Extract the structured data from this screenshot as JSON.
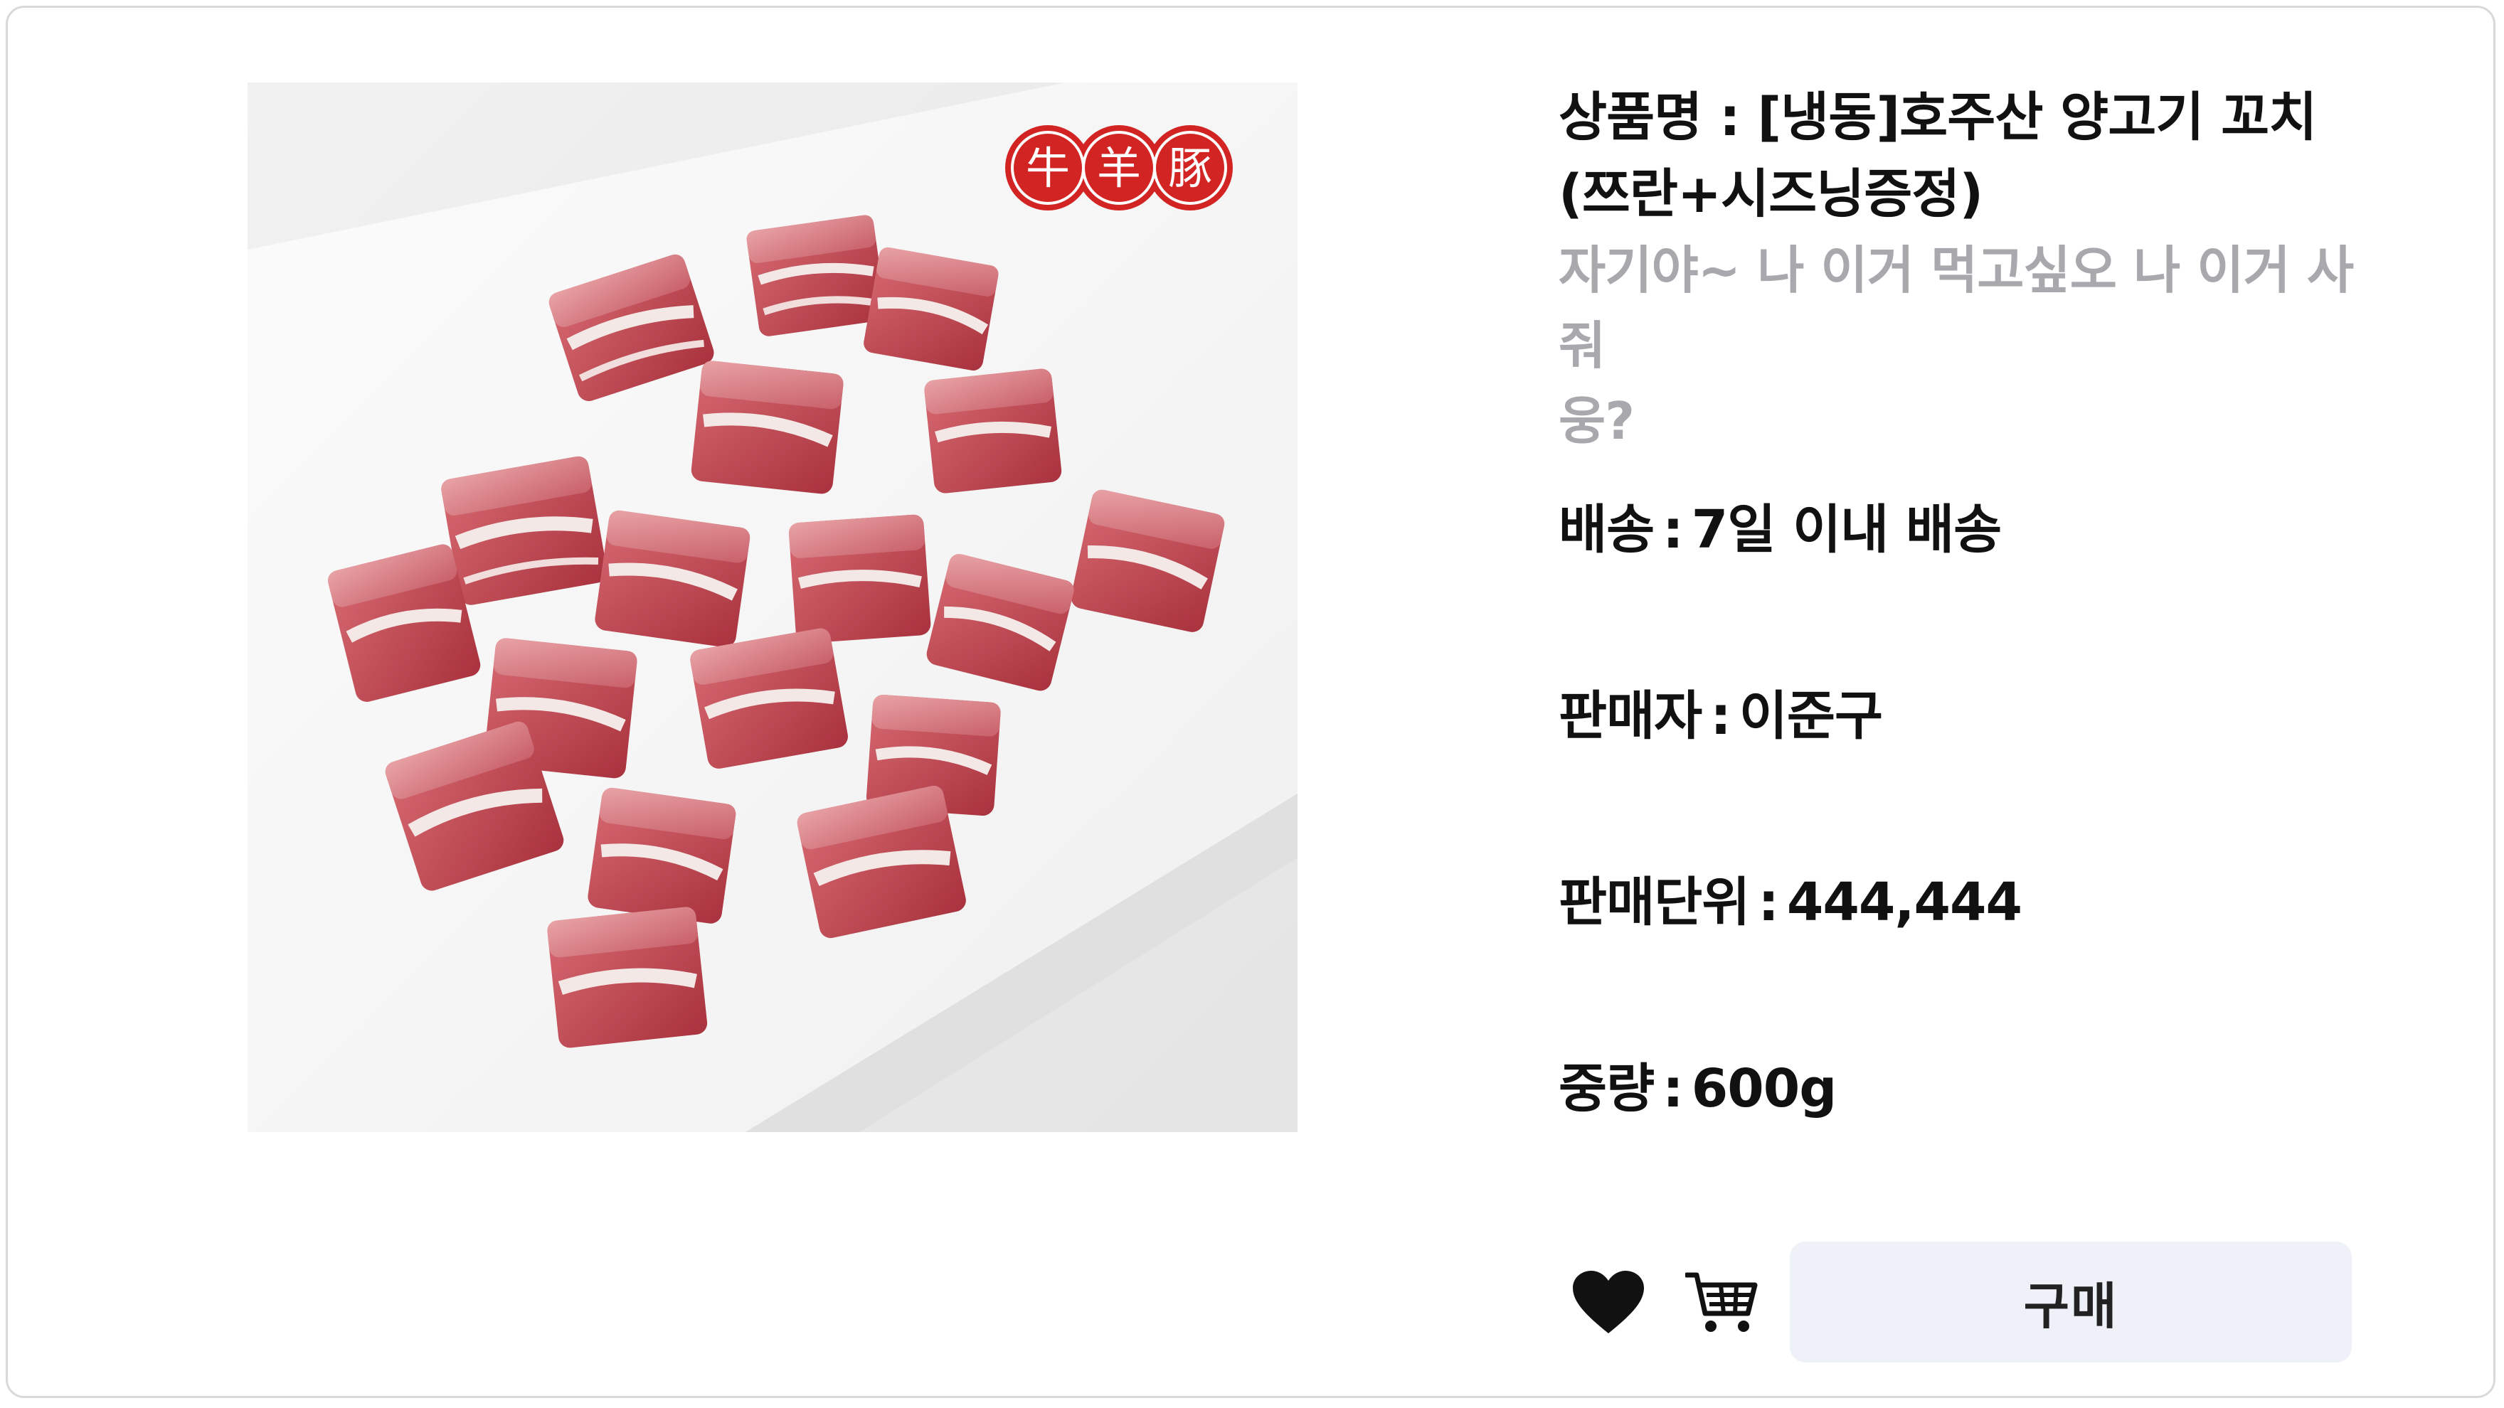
{
  "product": {
    "title_line1": "상품명 : [냉동]호주산 양고기 꼬치",
    "title_line2": "(쯔란+시즈닝증정)",
    "subtitle_line1": "자기야~ 나 이거 먹고싶오 나 이거 사줘",
    "subtitle_line2": "웅?",
    "image_logo_text": "牛羊豚"
  },
  "details": [
    {
      "label": "배송",
      "value": "7일 이내 배송"
    },
    {
      "label": "판매자",
      "value": "이준구"
    },
    {
      "label": "판매단위",
      "value": "444,444"
    },
    {
      "label": "중량",
      "value": "600g"
    }
  ],
  "separator": ":",
  "actions": {
    "buy_label": "구매",
    "like_icon": "heart-icon",
    "cart_icon": "cart-icon"
  },
  "colors": {
    "text": "#111111",
    "subtitle": "#a9a9ad",
    "buy_button_bg": "#eef1f7",
    "logo_red": "#d32424"
  }
}
